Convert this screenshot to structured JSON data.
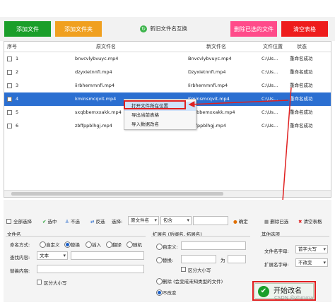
{
  "toolbar": {
    "add_file": "添加文件",
    "add_folder": "添加文件夹",
    "swap_names": "新旧文件名互换",
    "delete_selected_file": "删除已选的文件",
    "clear_table": "清空表格"
  },
  "table": {
    "headers": [
      "序号",
      "原文件名",
      "新文件名",
      "文件位置",
      "状态"
    ],
    "rows": [
      {
        "index": "1",
        "original": "bnvcvlybvuyc.mp4",
        "new": "Bnvcvlybvuyc.mp4",
        "location": "C:\\Us...",
        "status": "重命名成功"
      },
      {
        "index": "2",
        "original": "dzyxietnnfi.mp4",
        "new": "Dzyxietnnfi.mp4",
        "location": "C:\\Us...",
        "status": "重命名成功"
      },
      {
        "index": "3",
        "original": "iirbhemmnfi.mp4",
        "new": "Iirbhemmnfi.mp4",
        "location": "C:\\Us...",
        "status": "重命名成功"
      },
      {
        "index": "4",
        "original": "kminsmcqvit.mp4",
        "new": "Kminsmcqvit.mp4",
        "location": "C:\\Us...",
        "status": "重命名成功"
      },
      {
        "index": "5",
        "original": "sxqbbemxxakk.mp4",
        "new": "Sxqbbemxxakk.mp4",
        "location": "C:\\Us...",
        "status": "重命名成功"
      },
      {
        "index": "6",
        "original": "zbffppblhgj.mp4",
        "new": "Zbffppblhgj.mp4",
        "location": "C:\\Us...",
        "status": "重命名成功"
      }
    ]
  },
  "context_menu": {
    "open_location": "打开文件所在位置",
    "export_table": "导出当前表格",
    "import_data": "导入数据改名"
  },
  "select_bar": {
    "select_all": "全部选择",
    "select": "选中",
    "deselect": "不选",
    "invert": "反选",
    "select_label": "选择:",
    "field_value": "原文件名",
    "mode_value": "包含",
    "confirm": "确定",
    "delete_selected": "删除已选",
    "clear_table": "清空表格"
  },
  "filename_panel": {
    "title": "文件名",
    "naming_label": "命名方式:",
    "opt_custom": "自定义",
    "opt_replace": "替换",
    "opt_insert": "插入",
    "opt_translate": "翻译",
    "opt_random": "随机",
    "find_label": "查找内容:",
    "find_value": "文本",
    "replace_label": "替换内容:",
    "case_label": "区分大小写"
  },
  "ext_panel": {
    "title": "扩展名 (后缀名, 拓展名)",
    "custom": "自定义:",
    "replace": "替换:",
    "for_label": "为",
    "case_label": "区分大小写",
    "delete": "删除 (会变成未知类型的文件)",
    "unchanged": "不改变"
  },
  "other_panel": {
    "title": "其他选项",
    "case_label": "文件名字母:",
    "case_value": "首字大写",
    "ext_case_label": "扩展名字母:",
    "ext_case_value": "不改变"
  },
  "start_button": "开始改名",
  "watermark": "CSDN @zhmma",
  "colors": {
    "green": "#1a9e2a",
    "orange": "#f0a020",
    "pink": "#ff4b8a",
    "red": "#ee1c1c",
    "selected_row": "#2b6fd1",
    "highlight": "#e02020"
  }
}
